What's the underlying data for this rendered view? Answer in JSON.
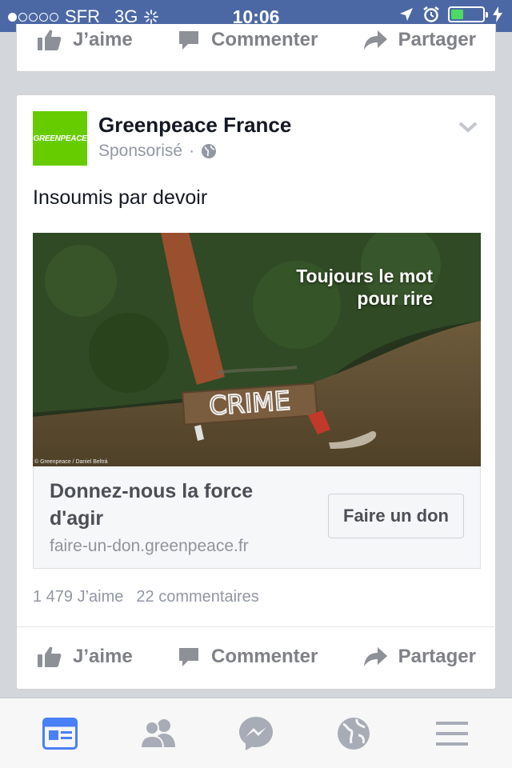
{
  "status_bar": {
    "carrier": "SFR",
    "network": "3G",
    "time": "10:06",
    "signal_bars": 1,
    "battery_level": 0.4
  },
  "top_actions": {
    "like": "J’aime",
    "comment": "Commenter",
    "share": "Partager"
  },
  "post": {
    "page_name": "Greenpeace France",
    "logo_text": "GREENPEACE",
    "sponsored_label": "Sponsorisé",
    "separator": "·",
    "text": "Insoumis par devoir",
    "image": {
      "overlay_line1": "Toujours le mot",
      "overlay_line2": "pour rire",
      "raft_text": "CRIME",
      "credit": "© Greenpeace / Daniel Beltrá"
    },
    "ad": {
      "headline": "Donnez-nous la force d'agir",
      "domain": "faire-un-don.greenpeace.fr",
      "cta": "Faire un don"
    },
    "likes_count": "1 479 J’aime",
    "comments_count": "22 commentaires",
    "actions": {
      "like": "J’aime",
      "comment": "Commenter",
      "share": "Partager"
    }
  },
  "tabs": [
    "news-feed",
    "friends",
    "messenger",
    "notifications",
    "more"
  ],
  "colors": {
    "status_bar": "#4c68a4",
    "accent": "#4a80f5",
    "greenpeace": "#66cc00",
    "tab_inactive": "#a7acb6"
  }
}
